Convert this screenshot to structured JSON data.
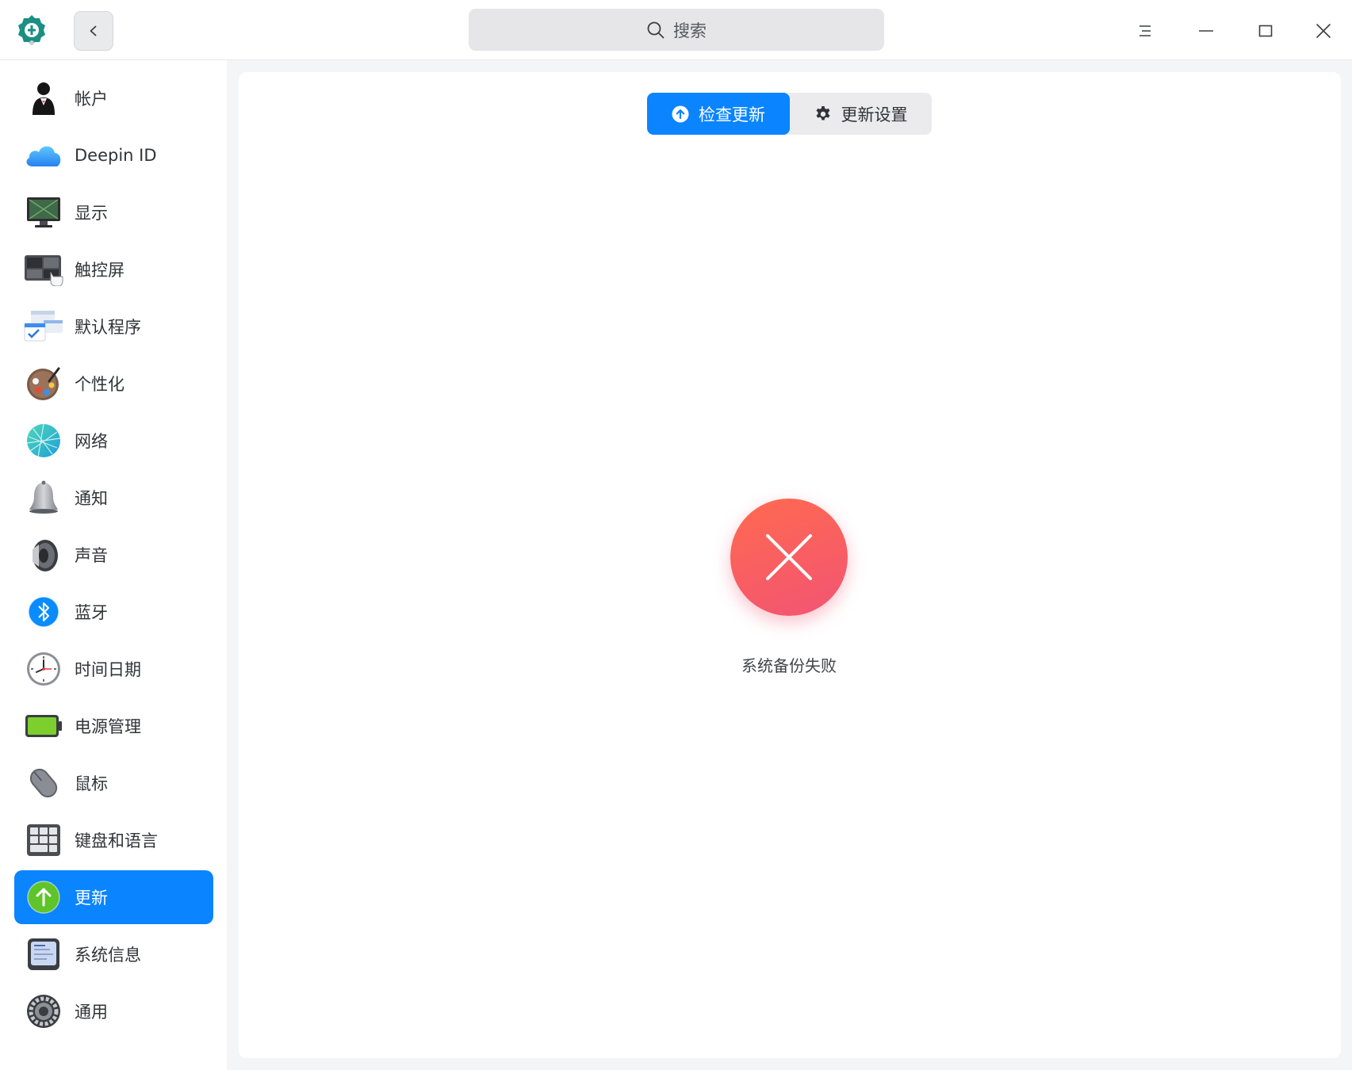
{
  "titlebar": {
    "search_placeholder": "搜索",
    "icons": [
      "app-logo-icon",
      "chevron-left-icon",
      "search-icon",
      "menu-icon",
      "minimize-icon",
      "maximize-icon",
      "close-icon"
    ]
  },
  "sidebar": {
    "items": [
      {
        "label": "帐户",
        "icon": "account-icon"
      },
      {
        "label": "Deepin ID",
        "icon": "cloud-icon"
      },
      {
        "label": "显示",
        "icon": "display-icon"
      },
      {
        "label": "触控屏",
        "icon": "touchscreen-icon"
      },
      {
        "label": "默认程序",
        "icon": "default-apps-icon"
      },
      {
        "label": "个性化",
        "icon": "palette-icon"
      },
      {
        "label": "网络",
        "icon": "network-icon"
      },
      {
        "label": "通知",
        "icon": "bell-icon"
      },
      {
        "label": "声音",
        "icon": "speaker-icon"
      },
      {
        "label": "蓝牙",
        "icon": "bluetooth-icon"
      },
      {
        "label": "时间日期",
        "icon": "clock-icon"
      },
      {
        "label": "电源管理",
        "icon": "battery-icon"
      },
      {
        "label": "鼠标",
        "icon": "mouse-icon"
      },
      {
        "label": "键盘和语言",
        "icon": "keyboard-icon"
      },
      {
        "label": "更新",
        "icon": "update-arrow-icon",
        "active": true
      },
      {
        "label": "系统信息",
        "icon": "system-info-icon"
      },
      {
        "label": "通用",
        "icon": "gear-icon"
      }
    ]
  },
  "main": {
    "tabs": [
      {
        "label": "检查更新",
        "icon": "upload-arrow-icon",
        "active": true
      },
      {
        "label": "更新设置",
        "icon": "gear-icon",
        "active": false
      }
    ],
    "status": {
      "message": "系统备份失败",
      "icon": "error-x-icon"
    }
  },
  "colors": {
    "accent": "#0a84ff",
    "error_gradient_start": "#ff6a4f",
    "error_gradient_end": "#f25474",
    "sidebar_bg": "#ffffff",
    "window_bg": "#f4f5f6"
  }
}
